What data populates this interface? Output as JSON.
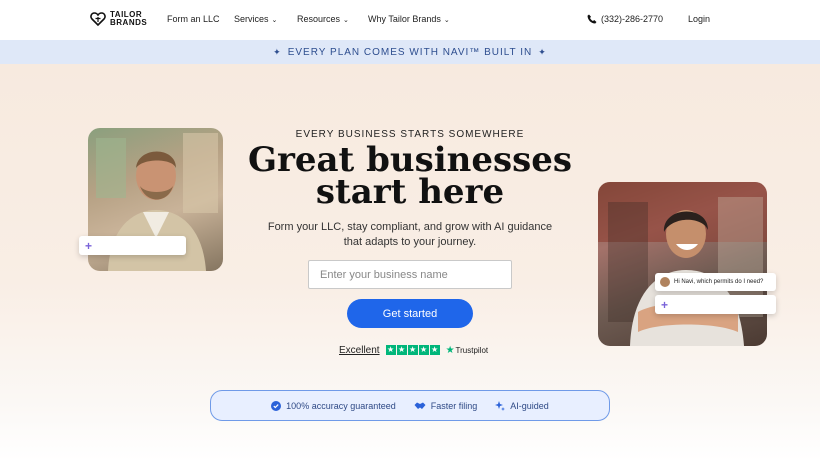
{
  "brand": {
    "line1": "TAILOR",
    "line2": "BRANDS"
  },
  "nav": {
    "items": [
      {
        "label": "Form an LLC",
        "has_menu": false
      },
      {
        "label": "Services",
        "has_menu": true
      },
      {
        "label": "Resources",
        "has_menu": true
      },
      {
        "label": "Why Tailor Brands",
        "has_menu": true
      }
    ],
    "phone": "(332)-286-2770",
    "login": "Login"
  },
  "banner": {
    "text": "EVERY PLAN COMES WITH NAVI™ BUILT IN"
  },
  "hero": {
    "eyebrow": "EVERY BUSINESS STARTS SOMEWHERE",
    "headline_line1": "Great businesses",
    "headline_line2": "start here",
    "sub_line1": "Form your LLC, stay compliant, and grow with AI guidance",
    "sub_line2": "that adapts to your journey.",
    "input_placeholder": "Enter your business name",
    "cta": "Get started",
    "rating_label": "Excellent",
    "trustpilot": "Trustpilot"
  },
  "chat_bubble": {
    "text": "Hi Navi, which permits do I need?"
  },
  "features": [
    {
      "label": "100% accuracy guaranteed",
      "icon": "check-badge-icon"
    },
    {
      "label": "Faster filing",
      "icon": "handshake-icon"
    },
    {
      "label": "AI-guided",
      "icon": "sparkle-icon"
    }
  ],
  "colors": {
    "accent": "#1f66ea",
    "banner_bg": "#dfe8f8",
    "trustpilot_green": "#00b67a",
    "navi_purple": "#7a63d9"
  }
}
